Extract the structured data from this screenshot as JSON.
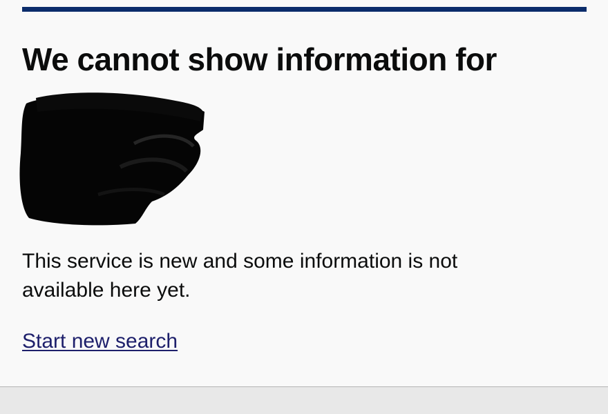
{
  "page": {
    "heading": "We cannot show information for",
    "body": "This service is new and some information is not available here yet.",
    "link_label": "Start new search"
  },
  "colors": {
    "accent_rule": "#0b2c6b",
    "link": "#1d1f6b",
    "background": "#f9f9f9",
    "footer": "#e8e8e8"
  }
}
